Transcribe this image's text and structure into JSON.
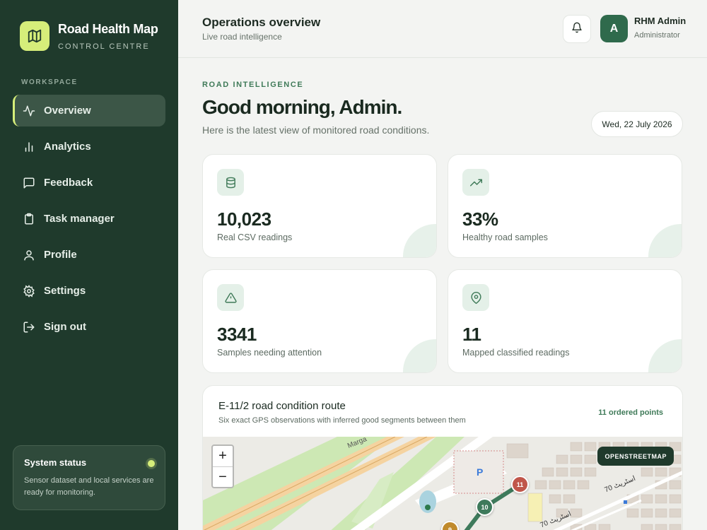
{
  "brand": {
    "name": "Road Health Map",
    "subtitle": "CONTROL CENTRE"
  },
  "sidebar": {
    "section_label": "WORKSPACE",
    "items": [
      {
        "label": "Overview",
        "icon": "activity-icon",
        "active": true
      },
      {
        "label": "Analytics",
        "icon": "bar-chart-icon"
      },
      {
        "label": "Feedback",
        "icon": "message-icon"
      },
      {
        "label": "Task manager",
        "icon": "clipboard-icon"
      },
      {
        "label": "Profile",
        "icon": "user-icon"
      },
      {
        "label": "Settings",
        "icon": "gear-icon"
      },
      {
        "label": "Sign out",
        "icon": "logout-icon"
      }
    ],
    "status": {
      "title": "System status",
      "text": "Sensor dataset and local services are ready for monitoring."
    }
  },
  "header": {
    "title": "Operations overview",
    "subtitle": "Live road intelligence",
    "user": {
      "initial": "A",
      "name": "RHM Admin",
      "role": "Administrator"
    }
  },
  "main": {
    "eyebrow": "ROAD INTELLIGENCE",
    "greeting": "Good morning, Admin.",
    "greeting_sub": "Here is the latest view of monitored road conditions.",
    "date": "Wed, 22 July 2026",
    "stats": [
      {
        "value": "10,023",
        "label": "Real CSV readings",
        "icon": "database-icon"
      },
      {
        "value": "33%",
        "label": "Healthy road samples",
        "icon": "trending-up-icon"
      },
      {
        "value": "3341",
        "label": "Samples needing attention",
        "icon": "alert-triangle-icon"
      },
      {
        "value": "11",
        "label": "Mapped classified readings",
        "icon": "map-pin-icon"
      }
    ],
    "map": {
      "title": "E-11/2 road condition route",
      "subtitle": "Six exact GPS observations with inferred good segments between them",
      "count": "11 ordered points",
      "badge": "OPENSTREETMAP",
      "zoom_in": "+",
      "zoom_out": "−",
      "road_label": "Marga",
      "street_label_1": "70 اسٹریٹ",
      "street_label_2": "70 اسٹریٹ",
      "parking": "P",
      "markers": [
        {
          "label": "11",
          "color": "#c0564a"
        },
        {
          "label": "10",
          "color": "#3e7a5b"
        },
        {
          "label": "9",
          "color": "#c08a2c"
        }
      ]
    }
  },
  "colors": {
    "sidebar": "#1f3a2c",
    "accent": "#d6ee7a",
    "primary": "#2f6a4c"
  }
}
